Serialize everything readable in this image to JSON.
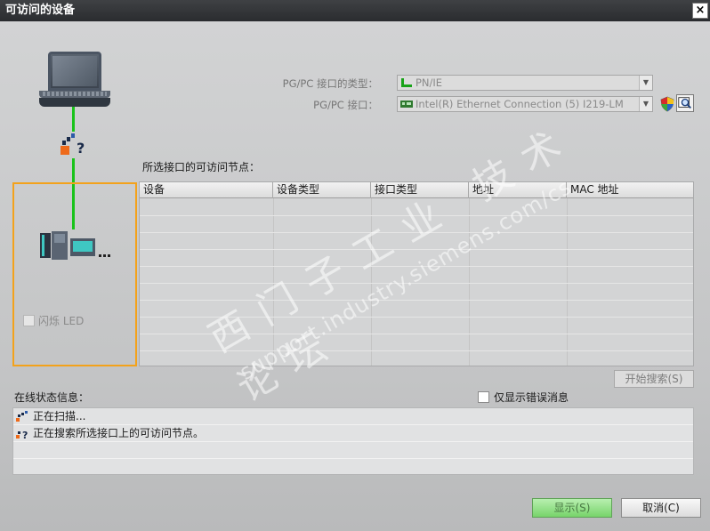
{
  "window": {
    "title": "可访问的设备",
    "close_icon": "×"
  },
  "pgpc": {
    "type_label": "PG/PC 接口的类型：",
    "type_value": "PN/IE",
    "iface_label": "PG/PC 接口：",
    "iface_value": "Intel(R) Ethernet Connection (5) I219-LM"
  },
  "nodes": {
    "label": "所选接口的可访问节点：",
    "columns": [
      "设备",
      "设备类型",
      "接口类型",
      "地址",
      "MAC 地址"
    ],
    "rows": []
  },
  "device_panel": {
    "flash_led_label": "闪烁 LED"
  },
  "buttons": {
    "start_search": "开始搜索(S)",
    "display": "显示(S)",
    "cancel": "取消(C)"
  },
  "status": {
    "label": "在线状态信息：",
    "errors_only_label": "仅显示错误消息",
    "messages": [
      "正在扫描...",
      "正在搜索所选接口上的可访问节点。"
    ]
  },
  "watermark": {
    "text_cn": "西门子工业  技术论坛",
    "text_url": "support.industry.siemens.com/cs"
  },
  "colors": {
    "accent_orange": "#f3a21b",
    "link_green": "#19c31a",
    "display_green": "#77d46a"
  }
}
